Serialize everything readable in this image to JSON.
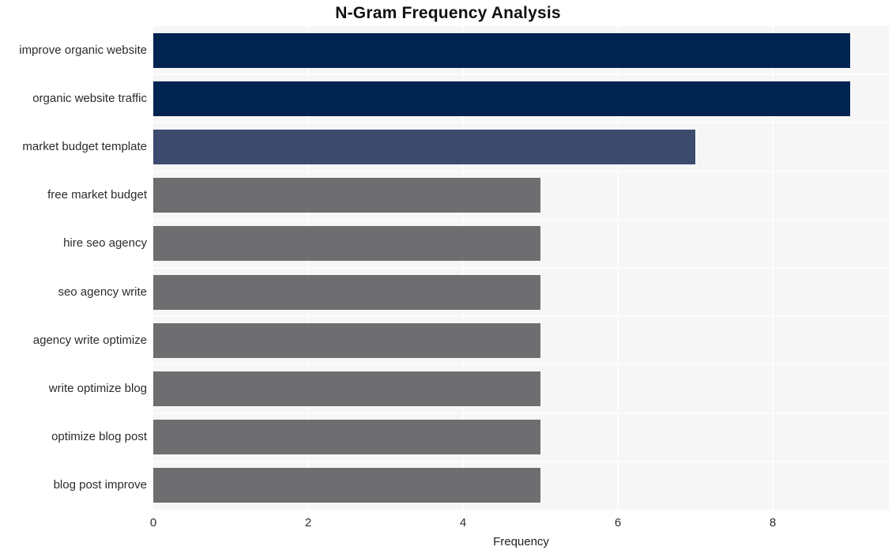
{
  "chart_data": {
    "type": "bar",
    "orientation": "horizontal",
    "title": "N-Gram Frequency Analysis",
    "xlabel": "Frequency",
    "ylabel": "",
    "categories": [
      "improve organic website",
      "organic website traffic",
      "market budget template",
      "free market budget",
      "hire seo agency",
      "seo agency write",
      "agency write optimize",
      "write optimize blog",
      "optimize blog post",
      "blog post improve"
    ],
    "values": [
      9,
      9,
      7,
      5,
      5,
      5,
      5,
      5,
      5,
      5
    ],
    "bar_colors": [
      "#022450",
      "#022450",
      "#3c4a6e",
      "#6e6e71",
      "#6e6e71",
      "#6e6e71",
      "#6e6e71",
      "#6e6e71",
      "#6e6e71",
      "#6e6e71"
    ],
    "xlim": [
      0,
      9.5
    ],
    "xticks": [
      0,
      2,
      4,
      6,
      8
    ],
    "xtick_labels": [
      "0",
      "2",
      "4",
      "6",
      "8"
    ],
    "grid": true,
    "legend": false,
    "plot_background": "#f6f6f7",
    "grid_color": "#fdfdfd",
    "figure_background": "#ffffff"
  }
}
